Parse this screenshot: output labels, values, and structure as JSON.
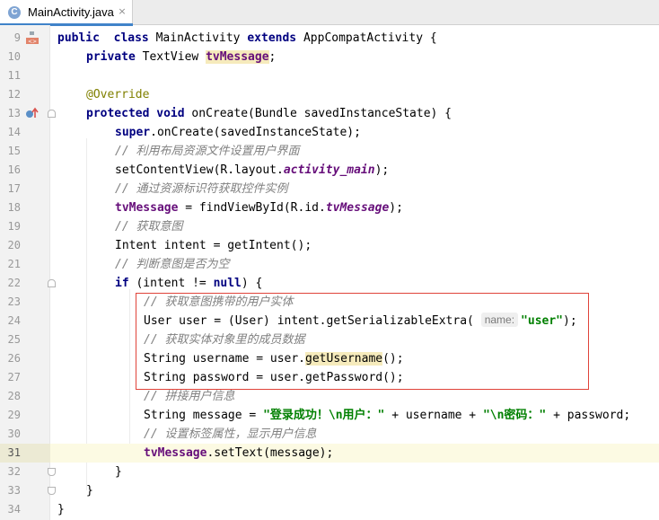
{
  "tab": {
    "icon_letter": "C",
    "title": "MainActivity.java",
    "close_glyph": "×"
  },
  "lines": [
    {
      "n": "9",
      "indent": 0,
      "tokens": [
        [
          "kw",
          "public"
        ],
        [
          "",
          "  "
        ],
        [
          "kw",
          "class"
        ],
        [
          "",
          " MainActivity "
        ],
        [
          "kw",
          "extends"
        ],
        [
          "",
          " AppCompatActivity {"
        ]
      ]
    },
    {
      "n": "10",
      "indent": 1,
      "tokens": [
        [
          "kw",
          "private"
        ],
        [
          "",
          " TextView "
        ],
        [
          "fld hl",
          "tvMessage"
        ],
        [
          "",
          ";"
        ]
      ]
    },
    {
      "n": "11",
      "indent": 0,
      "tokens": []
    },
    {
      "n": "12",
      "indent": 1,
      "tokens": [
        [
          "ann",
          "@Override"
        ]
      ]
    },
    {
      "n": "13",
      "indent": 1,
      "tokens": [
        [
          "kw",
          "protected"
        ],
        [
          "",
          ""
        ],
        [
          "kw",
          " void"
        ],
        [
          "",
          " onCreate(Bundle savedInstanceState) {"
        ]
      ]
    },
    {
      "n": "14",
      "indent": 2,
      "tokens": [
        [
          "kw",
          "super"
        ],
        [
          "",
          ".onCreate(savedInstanceState);"
        ]
      ]
    },
    {
      "n": "15",
      "indent": 2,
      "tokens": [
        [
          "cm",
          "// 利用布局资源文件设置用户界面"
        ]
      ]
    },
    {
      "n": "16",
      "indent": 2,
      "tokens": [
        [
          "",
          "setContentView(R.layout."
        ],
        [
          "sfld",
          "activity_main"
        ],
        [
          "",
          ");"
        ]
      ]
    },
    {
      "n": "17",
      "indent": 2,
      "tokens": [
        [
          "cm",
          "// 通过资源标识符获取控件实例"
        ]
      ]
    },
    {
      "n": "18",
      "indent": 2,
      "tokens": [
        [
          "fld",
          "tvMessage"
        ],
        [
          "",
          " = findViewById(R.id."
        ],
        [
          "sfld",
          "tvMessage"
        ],
        [
          "",
          ");"
        ]
      ]
    },
    {
      "n": "19",
      "indent": 2,
      "tokens": [
        [
          "cm",
          "// 获取意图"
        ]
      ]
    },
    {
      "n": "20",
      "indent": 2,
      "tokens": [
        [
          "",
          "Intent intent = getIntent();"
        ]
      ]
    },
    {
      "n": "21",
      "indent": 2,
      "tokens": [
        [
          "cm",
          "// 判断意图是否为空"
        ]
      ]
    },
    {
      "n": "22",
      "indent": 2,
      "tokens": [
        [
          "kw",
          "if"
        ],
        [
          "",
          " (intent != "
        ],
        [
          "kw",
          "null"
        ],
        [
          "",
          ") {"
        ]
      ]
    },
    {
      "n": "23",
      "indent": 3,
      "tokens": [
        [
          "cm",
          "// 获取意图携带的用户实体"
        ]
      ]
    },
    {
      "n": "24",
      "indent": 3,
      "tokens": [
        [
          "",
          "User user = (User) intent.getSerializableExtra( "
        ],
        [
          "hint",
          "name:"
        ],
        [
          "str",
          "\"user\""
        ],
        [
          "",
          ");"
        ]
      ]
    },
    {
      "n": "25",
      "indent": 3,
      "tokens": [
        [
          "cm",
          "// 获取实体对象里的成员数据"
        ]
      ]
    },
    {
      "n": "26",
      "indent": 3,
      "tokens": [
        [
          "",
          "String username = user."
        ],
        [
          "hl",
          "getUsername"
        ],
        [
          "",
          "();"
        ]
      ]
    },
    {
      "n": "27",
      "indent": 3,
      "tokens": [
        [
          "",
          "String password = user.getPassword();"
        ]
      ]
    },
    {
      "n": "28",
      "indent": 3,
      "tokens": [
        [
          "cm",
          "// 拼接用户信息"
        ]
      ]
    },
    {
      "n": "29",
      "indent": 3,
      "tokens": [
        [
          "",
          "String message = "
        ],
        [
          "str",
          "\"登录成功！\\n用户：\""
        ],
        [
          "",
          " + username + "
        ],
        [
          "str",
          "\"\\n密码：\""
        ],
        [
          "",
          " + password;"
        ]
      ]
    },
    {
      "n": "30",
      "indent": 3,
      "tokens": [
        [
          "cm",
          "// 设置标签属性，显示用户信息"
        ]
      ]
    },
    {
      "n": "31",
      "indent": 3,
      "tokens": [
        [
          "fld",
          "tvMessage"
        ],
        [
          "",
          ".setText(message);"
        ]
      ]
    },
    {
      "n": "32",
      "indent": 2,
      "tokens": [
        [
          "",
          "}"
        ]
      ]
    },
    {
      "n": "33",
      "indent": 1,
      "tokens": [
        [
          "",
          "}"
        ]
      ]
    },
    {
      "n": "34",
      "indent": 0,
      "tokens": [
        [
          "",
          "}"
        ]
      ]
    }
  ],
  "current_line": "31",
  "gutter_icons": {
    "9": "class-usages-icon",
    "13": "override-method-icon"
  },
  "fold_markers": {
    "13": "start",
    "22": "start",
    "32": "end",
    "33": "end"
  },
  "annotation_box": {
    "from_line": "23",
    "to_line": "27",
    "color": "#e0433a"
  }
}
